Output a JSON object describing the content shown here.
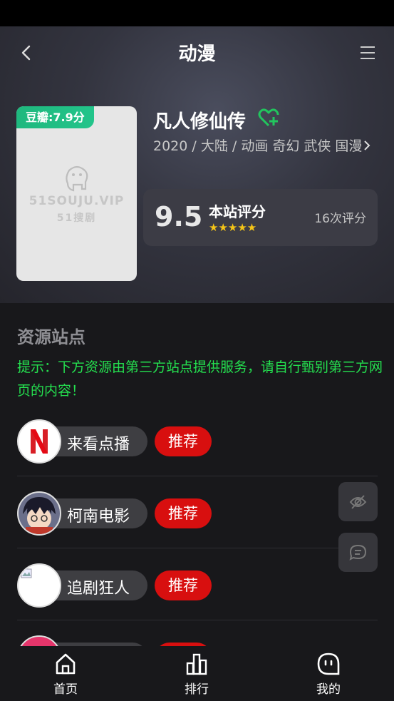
{
  "header": {
    "title": "动漫"
  },
  "poster": {
    "douban_badge": "豆瓣:7.9分",
    "watermark_line1": "51SOUJU.VIP",
    "watermark_line2": "51搜剧"
  },
  "show": {
    "name": "凡人修仙传",
    "meta": "2020 / 大陆 / 动画 奇幻 武侠 国漫",
    "rating": {
      "score": "9.5",
      "label": "本站评分",
      "stars": "★★★★★",
      "count": "16次评分"
    }
  },
  "resources": {
    "title": "资源站点",
    "notice": "提示：下方资源由第三方站点提供服务，请自行甄别第三方网页的内容！",
    "sites": [
      {
        "name": "来看点播",
        "tag": "推荐"
      },
      {
        "name": "柯南电影",
        "tag": "推荐"
      },
      {
        "name": "追剧狂人",
        "tag": "推荐"
      },
      {
        "name": "",
        "tag": ""
      }
    ]
  },
  "tabbar": {
    "items": [
      {
        "label": "首页"
      },
      {
        "label": "排行"
      },
      {
        "label": "我的"
      }
    ]
  },
  "colors": {
    "accent_green": "#24e04f",
    "tag_red": "#d80f0f",
    "douban_green": "#1fb87e"
  }
}
